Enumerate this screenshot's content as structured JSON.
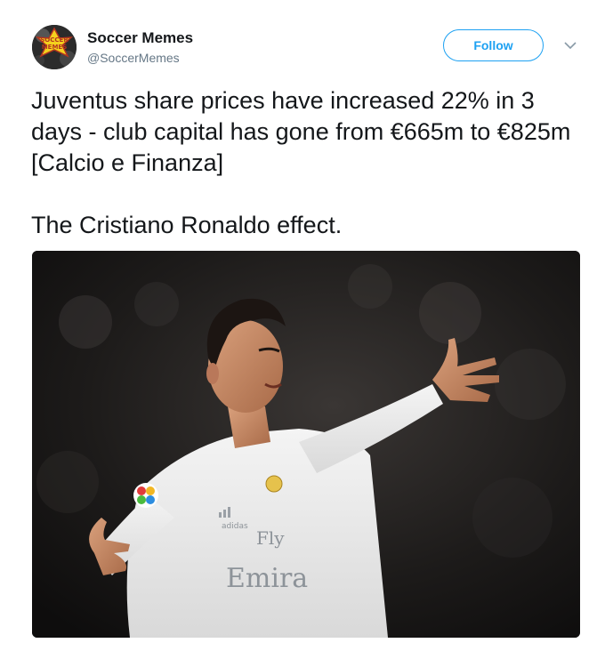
{
  "account": {
    "name": "Soccer Memes",
    "handle": "@SoccerMemes",
    "avatar_icon": "soccer-memes-logo",
    "avatar_logo_text": "SOCCER MEMES"
  },
  "actions": {
    "follow_label": "Follow",
    "more_icon": "chevron-down-icon"
  },
  "tweet": {
    "text": "Juventus share prices have increased 22% in 3 days - club capital has gone from €665m to €825m [Calcio e Finanza]\n\nThe Cristiano Ronaldo effect."
  },
  "media": {
    "kit_brand": "adidas",
    "sponsor_line1": "Fly",
    "sponsor_line2": "Emira"
  },
  "colors": {
    "accent": "#1da1f2",
    "text": "#14171a",
    "secondary_text": "#657786"
  }
}
